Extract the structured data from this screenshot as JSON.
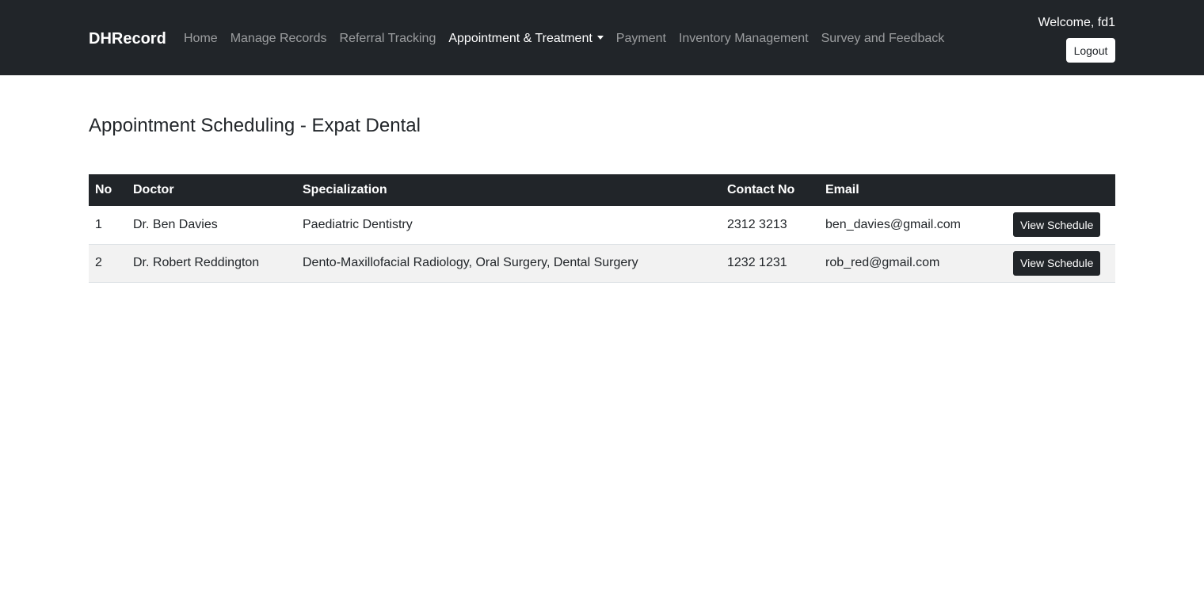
{
  "navbar": {
    "brand": "DHRecord",
    "links": [
      {
        "label": "Home",
        "active": false
      },
      {
        "label": "Manage Records",
        "active": false
      },
      {
        "label": "Referral Tracking",
        "active": false
      },
      {
        "label": "Appointment & Treatment",
        "active": true,
        "dropdown": true
      },
      {
        "label": "Payment",
        "active": false
      },
      {
        "label": "Inventory Management",
        "active": false
      },
      {
        "label": "Survey and Feedback",
        "active": false
      }
    ],
    "welcome": "Welcome, fd1",
    "logout_label": "Logout"
  },
  "main": {
    "title": "Appointment Scheduling - Expat Dental",
    "table": {
      "headers": [
        "No",
        "Doctor",
        "Specialization",
        "Contact No",
        "Email",
        ""
      ],
      "rows": [
        {
          "no": "1",
          "doctor": "Dr. Ben Davies",
          "specialization": "Paediatric Dentistry",
          "contact": "2312 3213",
          "email": "ben_davies@gmail.com",
          "action": "View Schedule"
        },
        {
          "no": "2",
          "doctor": "Dr. Robert Reddington",
          "specialization": "Dento-Maxillofacial Radiology, Oral Surgery, Dental Surgery",
          "contact": "1232 1231",
          "email": "rob_red@gmail.com",
          "action": "View Schedule"
        }
      ]
    }
  },
  "colors": {
    "navbar_bg": "#212529",
    "table_header_bg": "#212529",
    "striped_row_bg": "#f2f2f2"
  },
  "icons": {
    "dropdown": "caret-down-icon"
  }
}
